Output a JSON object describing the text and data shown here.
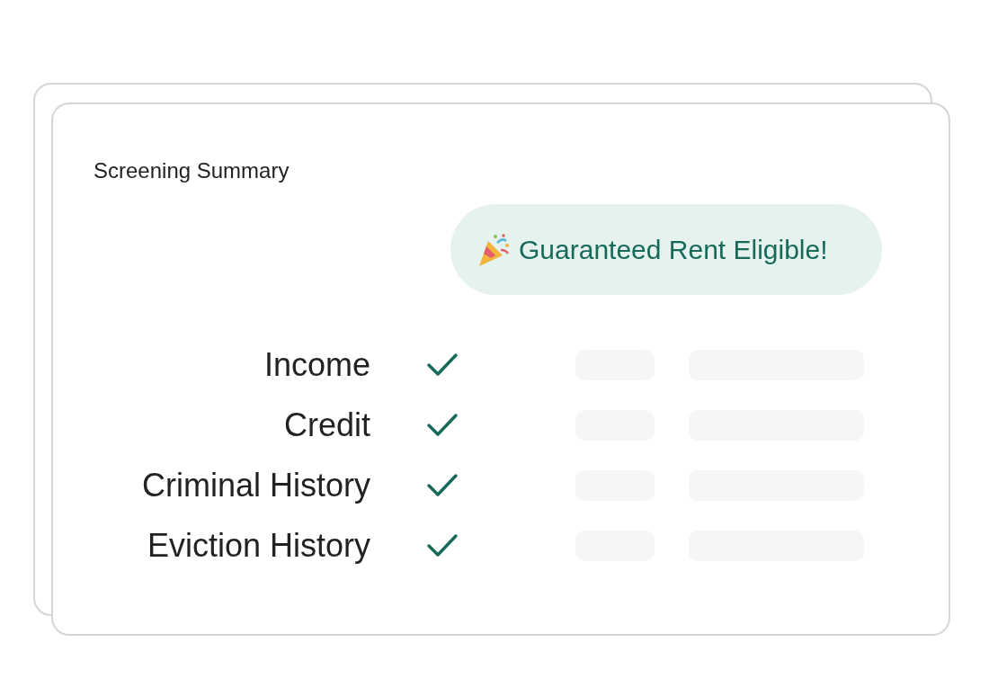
{
  "card": {
    "title": "Screening Summary"
  },
  "badge": {
    "label": "Guaranteed Rent Eligible!"
  },
  "checks": [
    {
      "label": "Income",
      "checked": true
    },
    {
      "label": "Credit",
      "checked": true
    },
    {
      "label": "Criminal History",
      "checked": true
    },
    {
      "label": "Eviction History",
      "checked": true
    }
  ]
}
